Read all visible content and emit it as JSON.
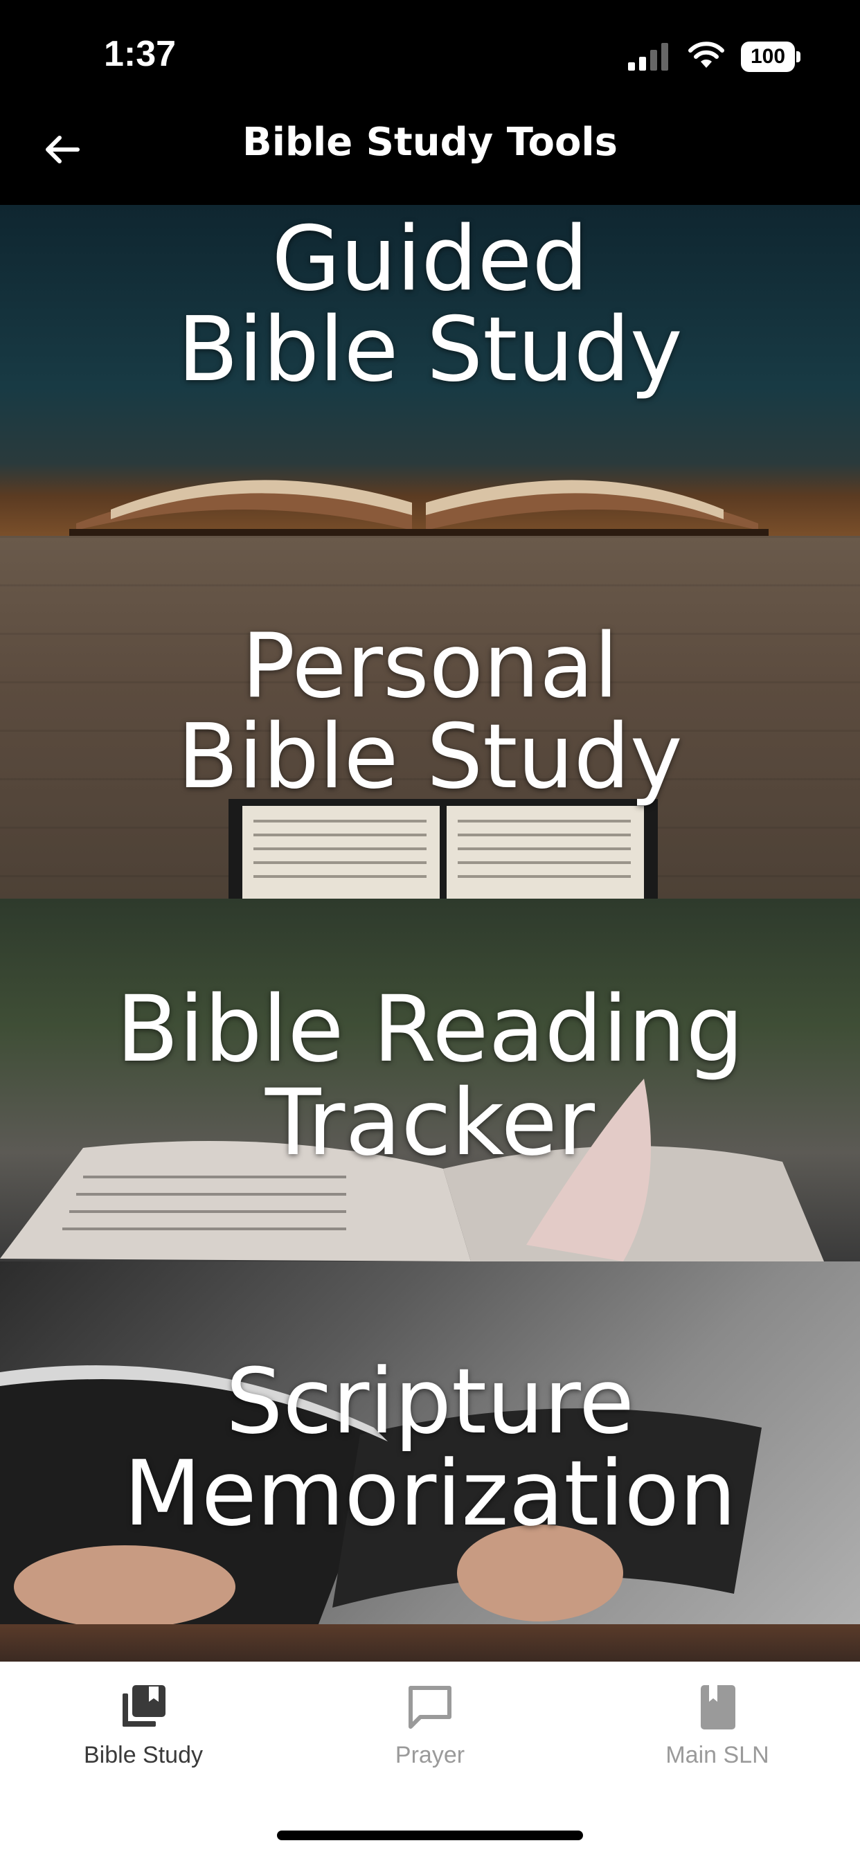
{
  "status_bar": {
    "time": "1:37",
    "battery": "100",
    "icons": [
      "cellular-signal-icon",
      "wifi-icon",
      "battery-icon"
    ]
  },
  "nav": {
    "title": "Bible Study Tools",
    "back_icon": "arrow-left-icon"
  },
  "tiles": [
    {
      "line1": "Guided",
      "line2": "Bible Study"
    },
    {
      "line1": "Personal",
      "line2": "Bible Study"
    },
    {
      "line1": "Bible Reading",
      "line2": "Tracker"
    },
    {
      "line1": "Scripture",
      "line2": "Memorization"
    }
  ],
  "tab_bar": {
    "tabs": [
      {
        "label": "Bible Study",
        "icon": "library-books-icon",
        "active": true
      },
      {
        "label": "Prayer",
        "icon": "chat-bubble-icon",
        "active": false
      },
      {
        "label": "Main SLN",
        "icon": "bookmark-book-icon",
        "active": false
      }
    ]
  },
  "colors": {
    "bar_background": "#000000",
    "tab_active": "#3a3a3a",
    "tab_inactive": "#9a9a9a"
  }
}
